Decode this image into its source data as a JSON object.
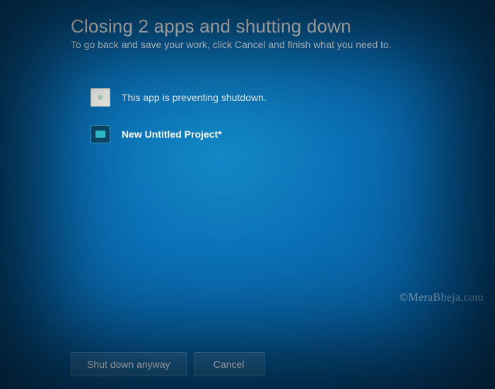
{
  "title": "Closing 2 apps and shutting down",
  "subtitle": "To go back and save your work, click Cancel and finish what you need to.",
  "apps": [
    {
      "label": "This app is preventing shutdown.",
      "icon": "blank-app-icon",
      "bold": false
    },
    {
      "label": "New Untitled Project*",
      "icon": "video-app-icon",
      "bold": true
    }
  ],
  "buttons": {
    "shutdown": "Shut down anyway",
    "cancel": "Cancel"
  },
  "watermark": "©MeraBheja.com"
}
